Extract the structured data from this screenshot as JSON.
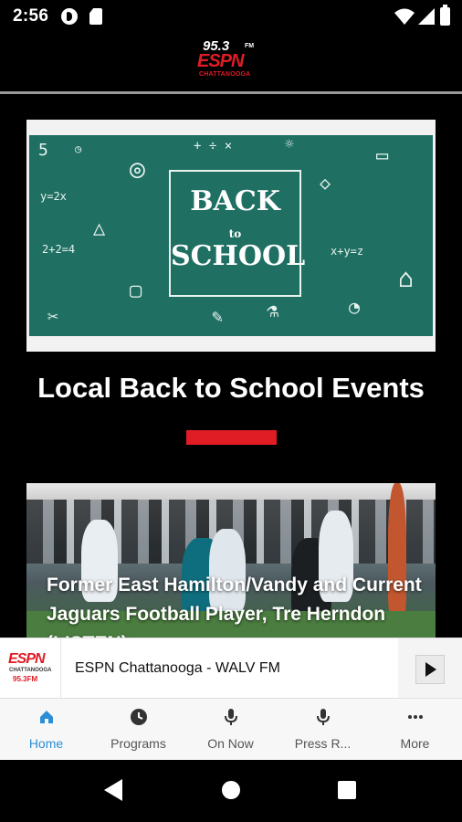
{
  "status_bar": {
    "time": "2:56"
  },
  "header": {
    "logo": {
      "frequency": "95.3",
      "band": "FM",
      "brand": "ESPN",
      "city": "CHATTANOOGA"
    }
  },
  "feed": [
    {
      "image_alt": "Back to school chalkboard",
      "image_text": [
        "BACK",
        "to",
        "SCHOOL"
      ],
      "title": "Local Back to School Events"
    },
    {
      "image_alt": "Football game photo",
      "title": "Former East Hamilton/Vandy and Current Jaguars Football Player, Tre Herndon (LISTEN)"
    }
  ],
  "now_playing": {
    "logo": {
      "brand": "ESPN",
      "city": "CHATTANOOGA",
      "frequency": "95.3FM"
    },
    "station": "ESPN Chattanooga - WALV FM",
    "play_icon": "play-icon"
  },
  "tabs": [
    {
      "label": "Home",
      "icon": "home-icon",
      "active": true
    },
    {
      "label": "Programs",
      "icon": "clock-icon",
      "active": false
    },
    {
      "label": "On Now",
      "icon": "microphone-icon",
      "active": false
    },
    {
      "label": "Press R...",
      "icon": "microphone-icon",
      "active": false
    },
    {
      "label": "More",
      "icon": "more-dots-icon",
      "active": false
    }
  ],
  "colors": {
    "accent": "#e01c24",
    "tab_active": "#2c8fd6",
    "chalkboard": "#1f6f62"
  }
}
